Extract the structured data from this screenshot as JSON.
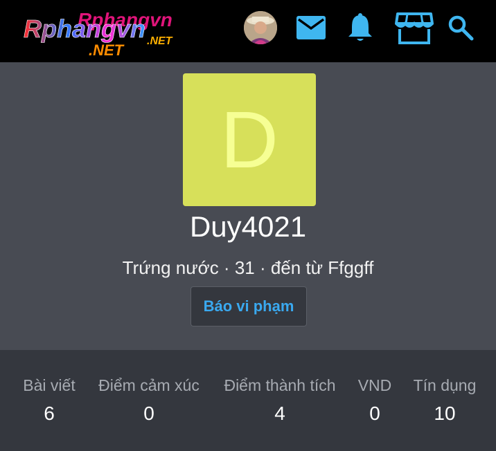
{
  "header": {
    "logo_text": "Rphangvn",
    "logo_suffix": ".NET",
    "icons": [
      "user-avatar",
      "mail-icon",
      "bell-icon",
      "store-icon",
      "search-icon"
    ]
  },
  "profile": {
    "avatar_letter": "D",
    "avatar_color": "#d7e05a",
    "username": "Duy4021",
    "blurb": "Trứng nước · 31 · đến từ Ffggff",
    "report_label": "Báo vi phạm"
  },
  "stats": [
    {
      "label": "Bài viết",
      "value": "6"
    },
    {
      "label": "Điểm cảm xúc",
      "value": "0"
    },
    {
      "label": "Điểm thành tích",
      "value": "4"
    },
    {
      "label": "VND",
      "value": "0"
    },
    {
      "label": "Tín dụng",
      "value": "10"
    }
  ],
  "colors": {
    "accent": "#3aa9f0",
    "header_bg": "#000000",
    "icon": "#3fb6f0"
  }
}
